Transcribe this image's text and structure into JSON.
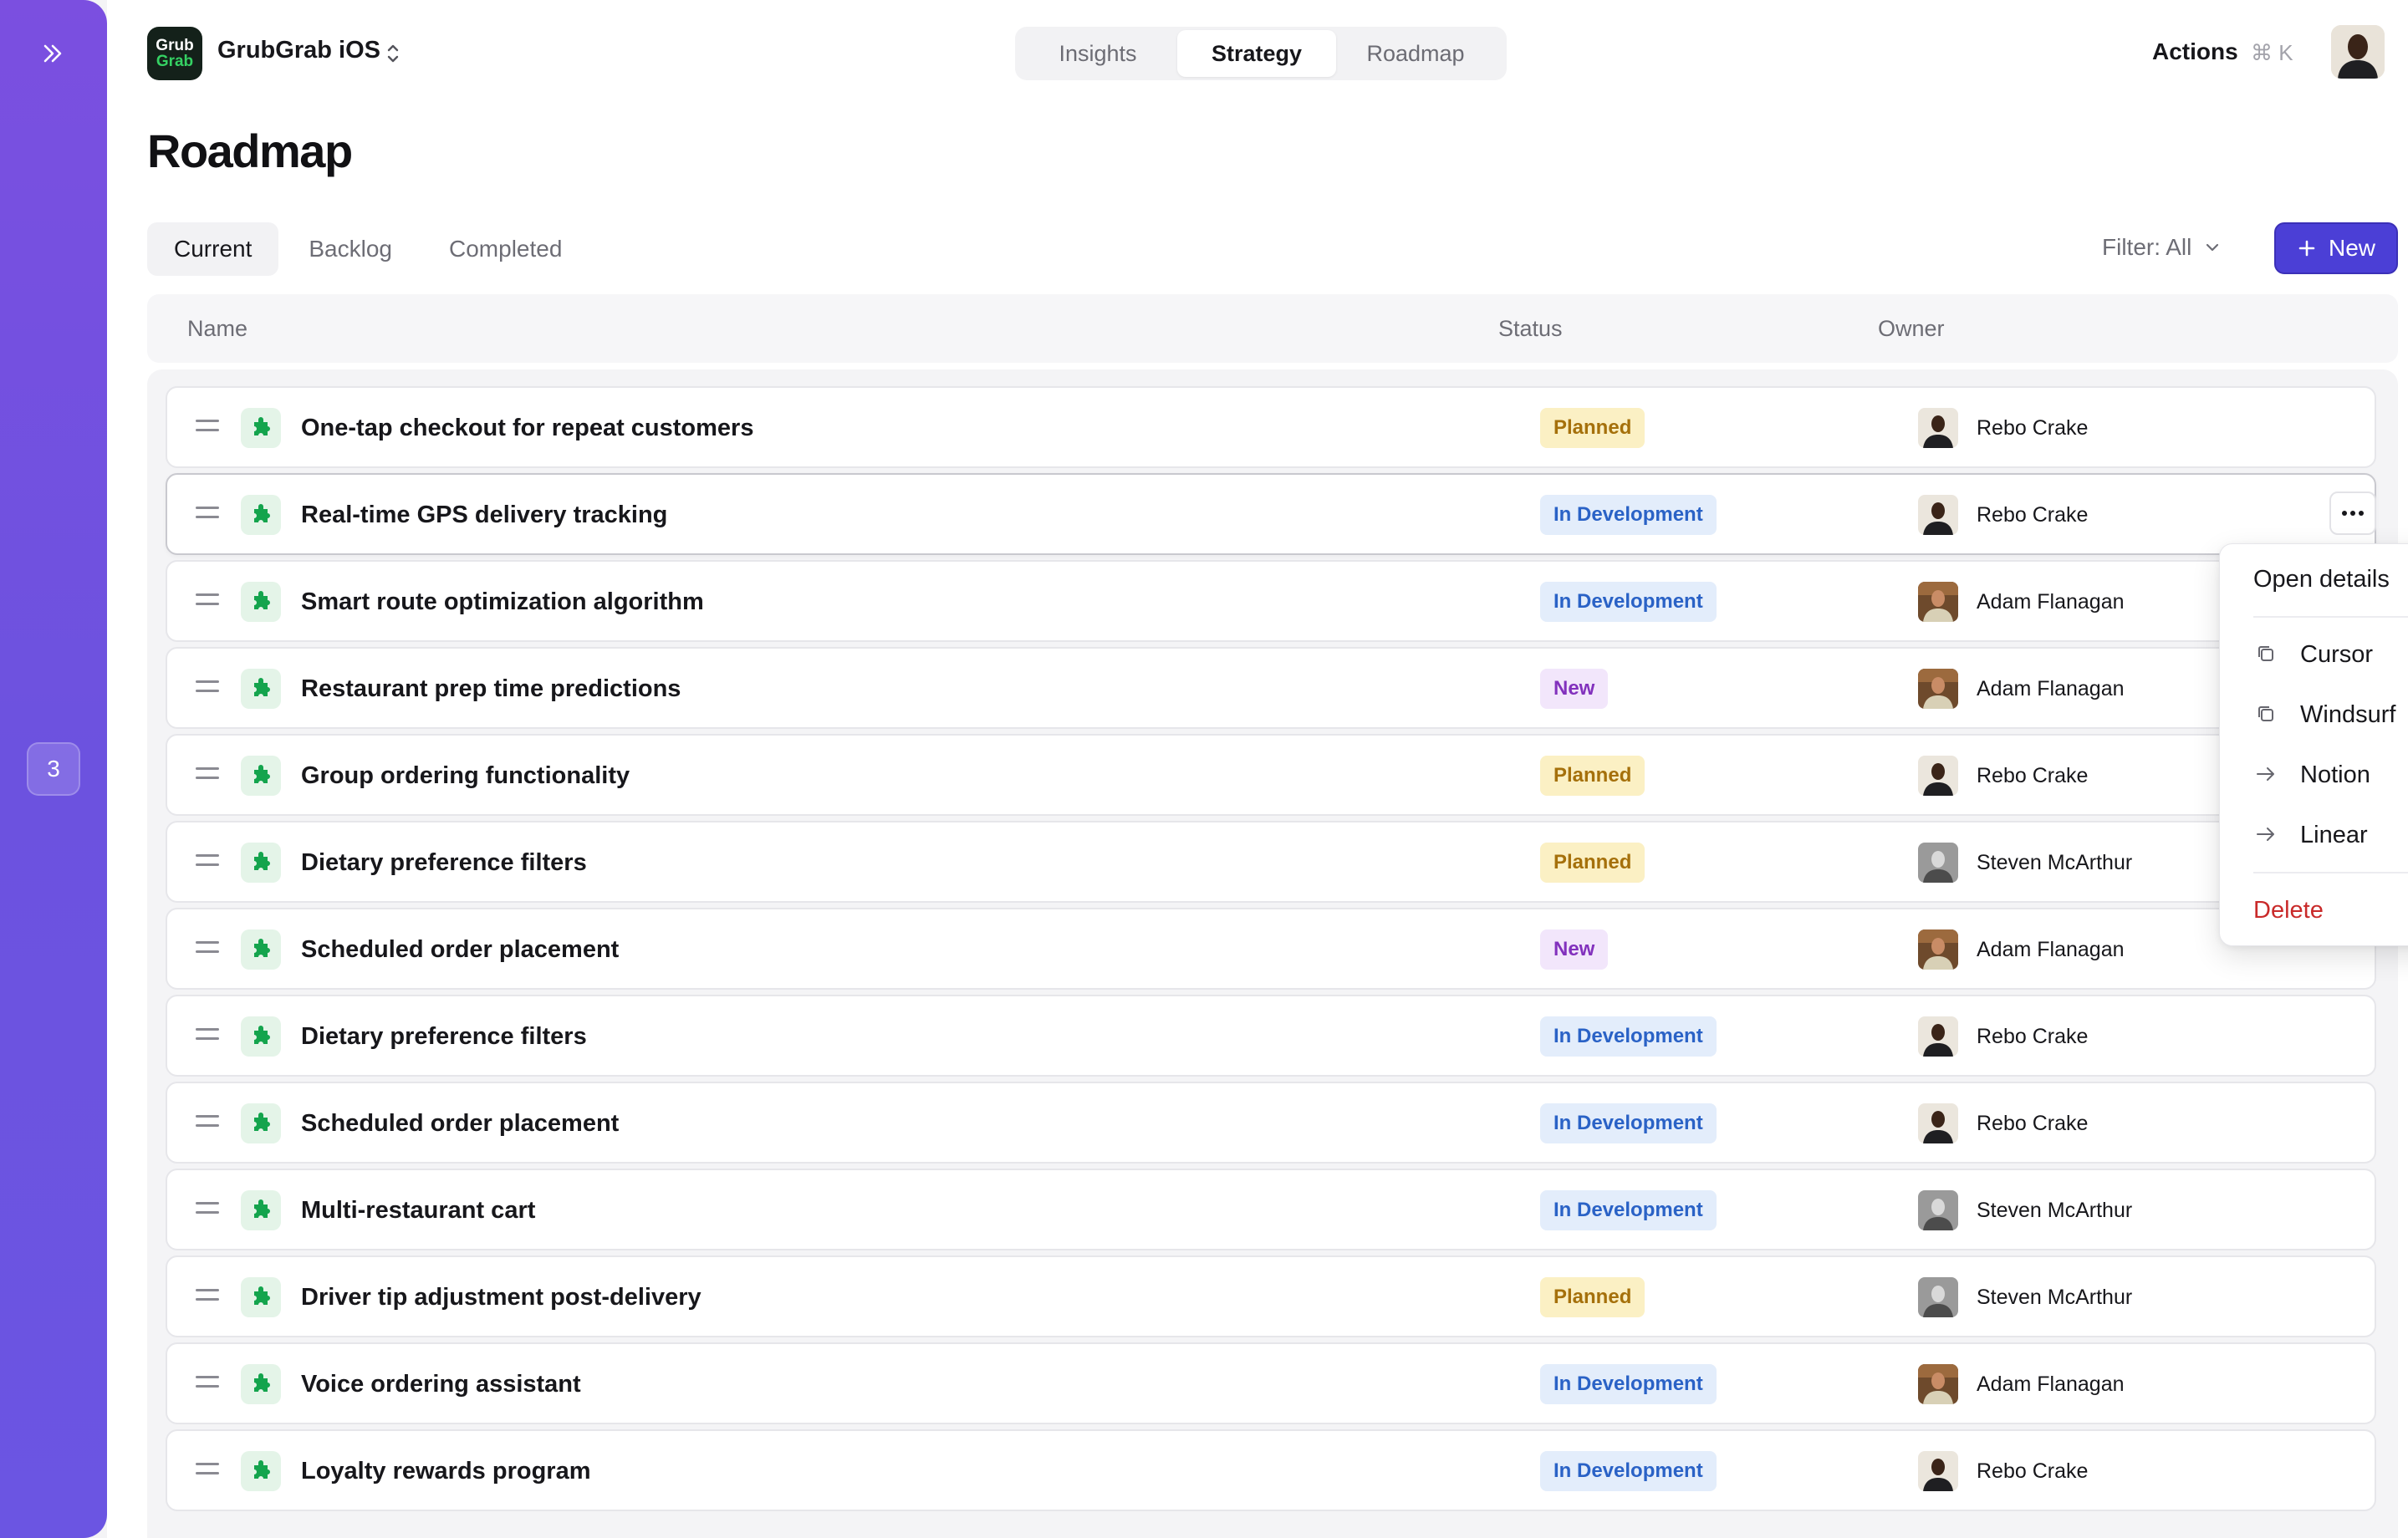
{
  "rail": {
    "badge_count": "3",
    "accent_colors": [
      "#7b4fe0",
      "#6b55e2"
    ]
  },
  "app": {
    "logo_line1": "Grub",
    "logo_line2": "Grab",
    "name": "GrubGrab iOS"
  },
  "nav_tabs": [
    "Insights",
    "Strategy",
    "Roadmap"
  ],
  "nav_active": "Strategy",
  "header": {
    "actions_label": "Actions",
    "shortcut": "⌘ K"
  },
  "page": {
    "title": "Roadmap"
  },
  "view_tabs": [
    {
      "label": "Current",
      "active": true
    },
    {
      "label": "Backlog",
      "active": false
    },
    {
      "label": "Completed",
      "active": false
    }
  ],
  "filter": {
    "label": "Filter: All"
  },
  "new_button": {
    "label": "New",
    "color": "#4b3fd6"
  },
  "table": {
    "columns": [
      "Name",
      "Status",
      "Owner"
    ],
    "rows": [
      {
        "name": "One-tap checkout for repeat customers",
        "status": "Planned",
        "owner": "Rebo Crake"
      },
      {
        "name": "Real-time GPS delivery tracking",
        "status": "In Development",
        "owner": "Rebo Crake"
      },
      {
        "name": "Smart route optimization algorithm",
        "status": "In Development",
        "owner": "Adam Flanagan"
      },
      {
        "name": "Restaurant prep time predictions",
        "status": "New",
        "owner": "Adam Flanagan"
      },
      {
        "name": "Group ordering functionality",
        "status": "Planned",
        "owner": "Rebo Crake"
      },
      {
        "name": "Dietary preference filters",
        "status": "Planned",
        "owner": "Steven McArthur"
      },
      {
        "name": "Scheduled order placement",
        "status": "New",
        "owner": "Adam Flanagan"
      },
      {
        "name": "Dietary preference filters",
        "status": "In Development",
        "owner": "Rebo Crake"
      },
      {
        "name": "Scheduled order placement",
        "status": "In Development",
        "owner": "Rebo Crake"
      },
      {
        "name": "Multi-restaurant cart",
        "status": "In Development",
        "owner": "Steven McArthur"
      },
      {
        "name": "Driver tip adjustment post-delivery",
        "status": "Planned",
        "owner": "Steven McArthur"
      },
      {
        "name": "Voice ordering assistant",
        "status": "In Development",
        "owner": "Adam Flanagan"
      },
      {
        "name": "Loyalty rewards program",
        "status": "In Development",
        "owner": "Rebo Crake"
      }
    ]
  },
  "status_colors": {
    "Planned": "#a5700b",
    "In Development": "#2a62c6",
    "New": "#8231bd"
  },
  "context_menu": {
    "open_details": "Open details",
    "items": [
      {
        "label": "Cursor",
        "icon": "copy-icon"
      },
      {
        "label": "Windsurf",
        "icon": "copy-icon"
      },
      {
        "label": "Notion",
        "icon": "arrow-right-icon"
      },
      {
        "label": "Linear",
        "icon": "arrow-right-icon"
      }
    ],
    "delete": "Delete"
  }
}
